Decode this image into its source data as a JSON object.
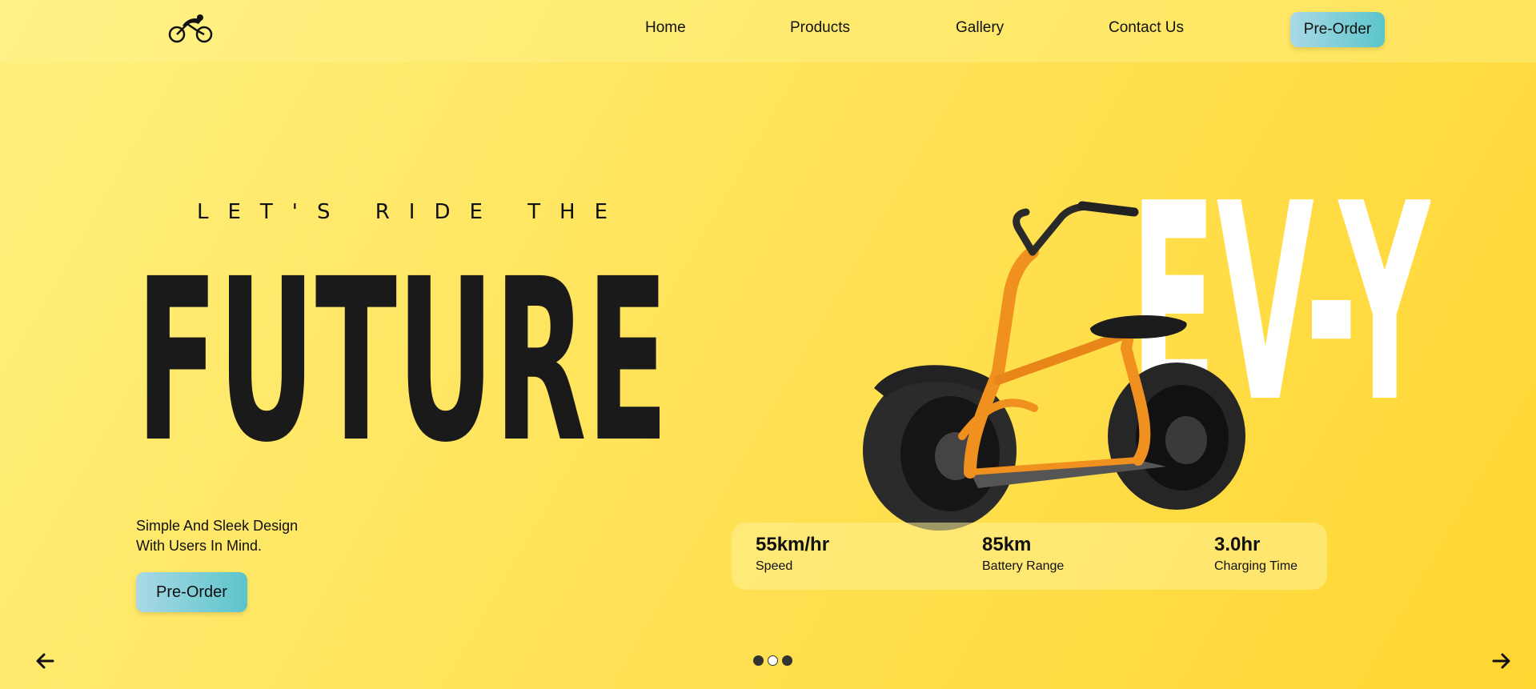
{
  "header": {
    "logo_icon": "bicycle-rider-icon",
    "nav": {
      "home": "Home",
      "products": "Products",
      "gallery": "Gallery",
      "contact": "Contact Us"
    },
    "preorder_label": "Pre-Order"
  },
  "hero": {
    "eyebrow": "LET'S RIDE THE",
    "title": "FUTURE",
    "tagline_line1": "Simple And Sleek Design",
    "tagline_line2": "With Users In Mind.",
    "preorder_label": "Pre-Order",
    "brand": "EV-Y",
    "product_image": "orange-electric-scooter"
  },
  "stats": [
    {
      "value": "55km/hr",
      "label": "Speed"
    },
    {
      "value": "85km",
      "label": "Battery Range"
    },
    {
      "value": "3.0hr",
      "label": "Charging Time"
    }
  ],
  "carousel": {
    "prev_icon": "arrow-left-icon",
    "next_icon": "arrow-right-icon",
    "slide_count": 3,
    "active_slide": 2
  },
  "colors": {
    "background_start": "#fff07f",
    "background_end": "#ffd632",
    "button_start": "#a9d9e6",
    "button_end": "#5bc4cb",
    "title": "#1a1a1a",
    "brand_text": "#ffffff",
    "scooter_frame": "#f0901e"
  }
}
